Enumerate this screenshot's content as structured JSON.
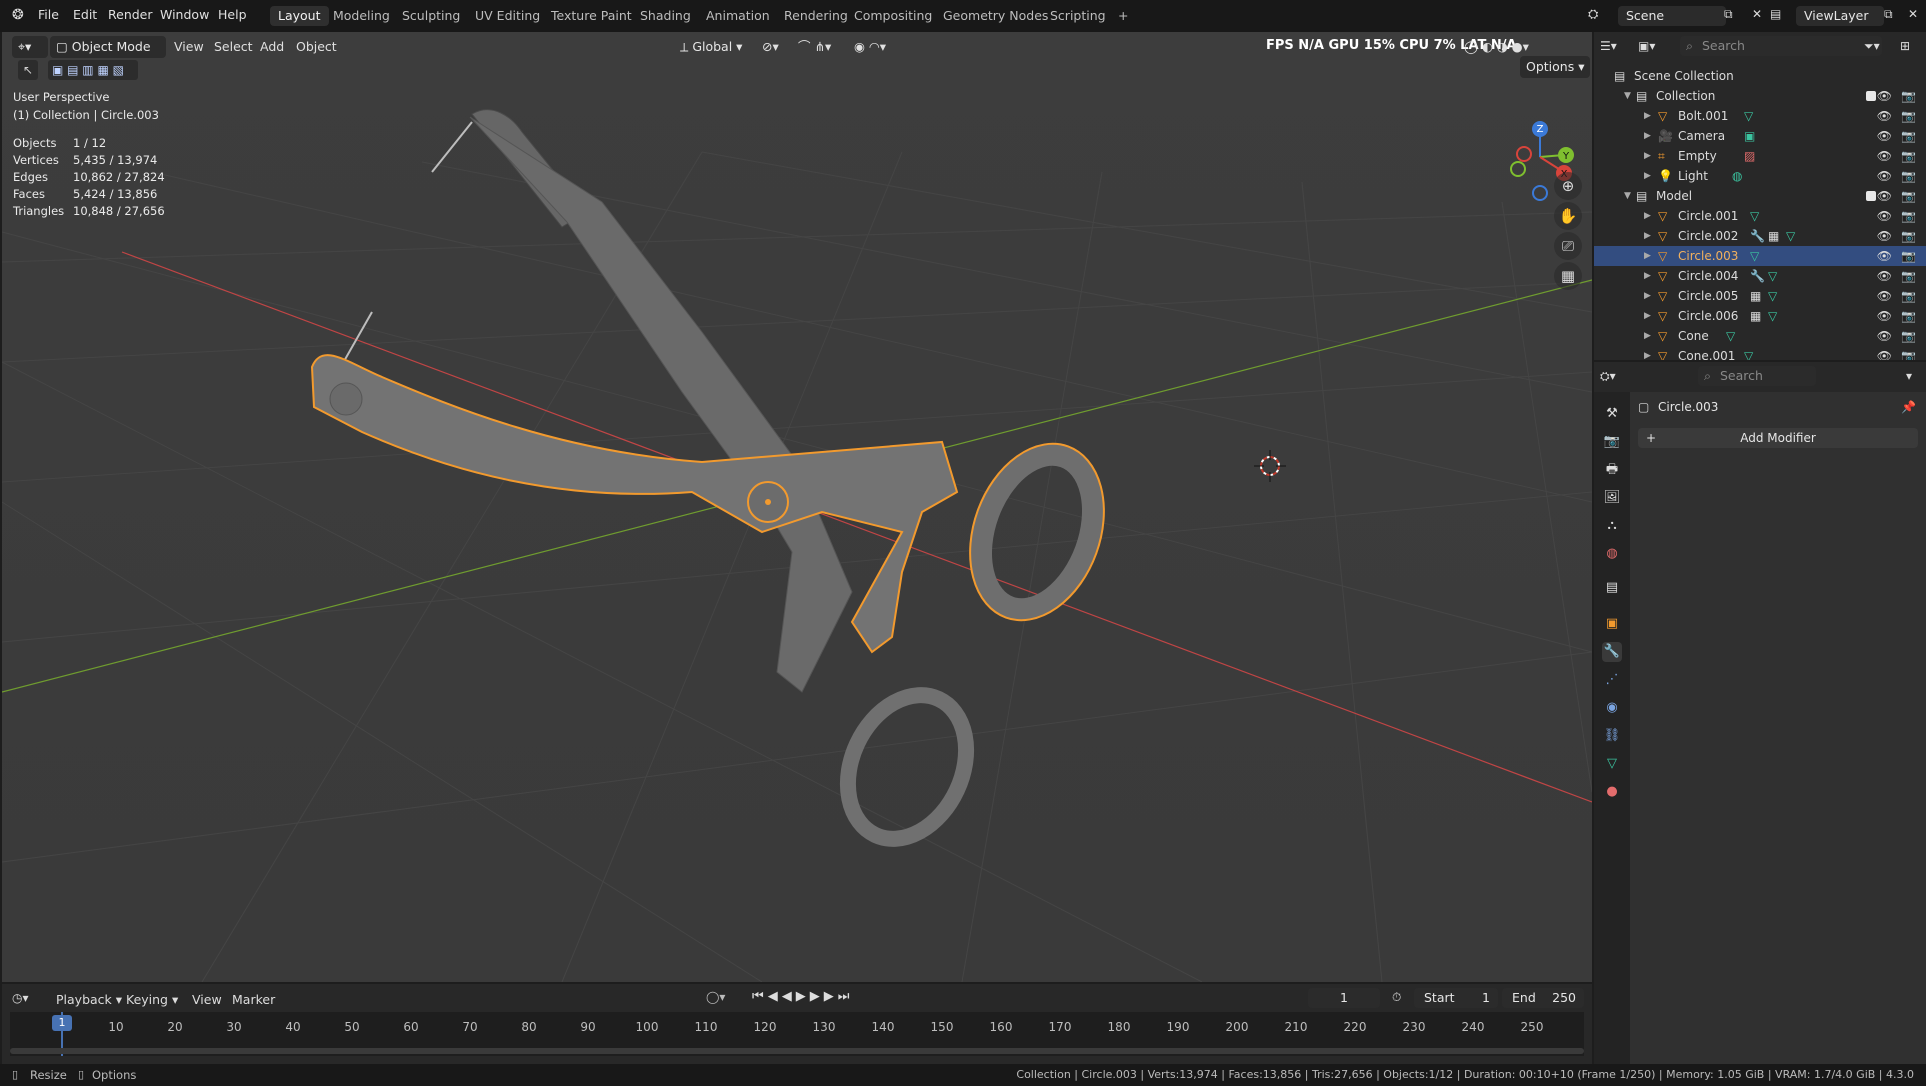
{
  "topbar": {
    "menus": [
      "File",
      "Edit",
      "Render",
      "Window",
      "Help"
    ],
    "workspaces": [
      "Layout",
      "Modeling",
      "Sculpting",
      "UV Editing",
      "Texture Paint",
      "Shading",
      "Animation",
      "Rendering",
      "Compositing",
      "Geometry Nodes",
      "Scripting"
    ],
    "active_workspace": "Layout",
    "add_tab": "+",
    "scene_label": "Scene",
    "viewlayer_label": "ViewLayer",
    "perf": "FPS N/A GPU 15% CPU 7% LAT N/A"
  },
  "viewport": {
    "mode": "Object Mode",
    "menus": [
      "View",
      "Select",
      "Add",
      "Object"
    ],
    "orientation": "Global",
    "options_label": "Options",
    "overlay_title": "User Perspective",
    "overlay_subtitle": "(1) Collection | Circle.003",
    "stats": [
      {
        "label": "Objects",
        "value": "1 / 12"
      },
      {
        "label": "Vertices",
        "value": "5,435 / 13,974"
      },
      {
        "label": "Edges",
        "value": "10,862 / 27,824"
      },
      {
        "label": "Faces",
        "value": "5,424 / 13,856"
      },
      {
        "label": "Triangles",
        "value": "10,848 / 27,656"
      }
    ],
    "gizmo_axes": [
      "Z",
      "Y",
      "X"
    ]
  },
  "outliner": {
    "search_placeholder": "Search",
    "root": "Scene Collection",
    "items": [
      {
        "name": "Collection",
        "kind": "collection",
        "level": 1,
        "expanded": true
      },
      {
        "name": "Bolt.001",
        "kind": "mesh",
        "level": 2
      },
      {
        "name": "Camera",
        "kind": "camera",
        "level": 2
      },
      {
        "name": "Empty",
        "kind": "empty",
        "level": 2
      },
      {
        "name": "Light",
        "kind": "light",
        "level": 2
      },
      {
        "name": "Model",
        "kind": "collection",
        "level": 1,
        "expanded": true
      },
      {
        "name": "Circle.001",
        "kind": "mesh",
        "level": 2
      },
      {
        "name": "Circle.002",
        "kind": "mesh",
        "level": 2
      },
      {
        "name": "Circle.003",
        "kind": "mesh",
        "level": 2,
        "selected": true
      },
      {
        "name": "Circle.004",
        "kind": "mesh",
        "level": 2
      },
      {
        "name": "Circle.005",
        "kind": "mesh",
        "level": 2
      },
      {
        "name": "Circle.006",
        "kind": "mesh",
        "level": 2
      },
      {
        "name": "Cone",
        "kind": "mesh",
        "level": 2
      },
      {
        "name": "Cone.001",
        "kind": "mesh",
        "level": 2
      }
    ]
  },
  "properties": {
    "search_placeholder": "Search",
    "object_name": "Circle.003",
    "add_modifier_label": "Add Modifier",
    "tabs": [
      "tool",
      "render",
      "output",
      "view-layer",
      "scene",
      "world",
      "collection",
      "object",
      "modifiers",
      "particles",
      "physics",
      "constraints",
      "data",
      "material"
    ]
  },
  "timeline": {
    "menus": [
      "Playback",
      "Keying",
      "View",
      "Marker"
    ],
    "current_frame": "1",
    "start_label": "Start",
    "start_value": "1",
    "end_label": "End",
    "end_value": "250",
    "ruler": [
      "10",
      "20",
      "30",
      "40",
      "50",
      "60",
      "70",
      "80",
      "90",
      "100",
      "110",
      "120",
      "130",
      "140",
      "150",
      "160",
      "170",
      "180",
      "190",
      "200",
      "210",
      "220",
      "230",
      "240",
      "250"
    ],
    "playhead_label": "1"
  },
  "statusbar": {
    "left_items": [
      "Resize",
      "Options"
    ],
    "info": "Collection | Circle.003 | Verts:13,974 | Faces:13,856 | Tris:27,656 | Objects:1/12 | Duration: 00:10+10 (Frame 1/250) | Memory: 1.05 GiB | VRAM: 1.7/4.0 GiB | 4.3.0"
  },
  "colors": {
    "accent": "#4772b3",
    "selection": "#f29a2e",
    "viewport_bg": "#3d3d3d",
    "x_axis": "#c04545",
    "y_axis": "#6f9c2f"
  }
}
